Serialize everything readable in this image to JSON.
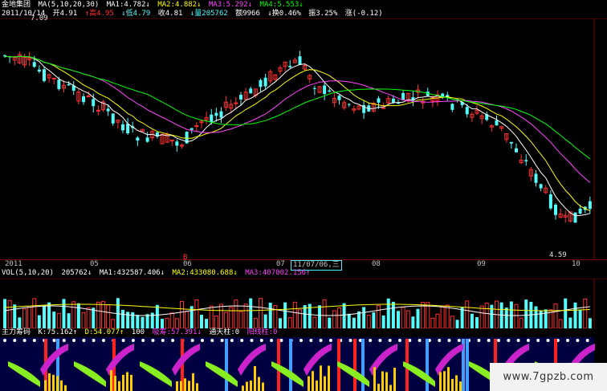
{
  "header": {
    "stock_name": "金地集团",
    "ma_title": "MA(5,10,20,30)",
    "ma1": "MA1:4.782↓",
    "ma2": "MA2:4.882↓",
    "ma3": "MA3:5.292↓",
    "ma4": "MA4:5.553↓",
    "colors": {
      "ma1": "#ffffff",
      "ma2": "#ffff00",
      "ma3": "#ff44ff",
      "ma4": "#00ff00",
      "name": "#ffffff"
    }
  },
  "quote": {
    "date": "2011/10/14",
    "open": "开4.91",
    "high": "↑高4.95",
    "low": "↓低4.79",
    "close": "收4.81",
    "volume": "↓量205762",
    "amount": "额9966",
    "turnover": "↓换0.46%",
    "amplitude": "振3.25%",
    "change": "涨(-0.12)"
  },
  "price_labels": {
    "high": "7.09",
    "low": "4.59",
    "marker": "B"
  },
  "date_axis": {
    "labels": [
      "2011",
      "05",
      "06",
      "07",
      "11/07/06,三",
      "08",
      "09",
      "10"
    ]
  },
  "volume_header": {
    "title": "VOL(5,10,20)",
    "vol": "205762↓",
    "ma1": "MA1:432587.406↓",
    "ma2": "MA2:433080.688↓",
    "ma3": "MA3:407002.156↑"
  },
  "indicator_header": {
    "name": "主力筹码",
    "k": "K:75.162↑",
    "d": "D:54.077↑",
    "n100": "100",
    "xichou": "吸筹:57.391↓",
    "tongtian": "通天柱:0",
    "yangxian": "阳线柱:0"
  },
  "watermark": "www.7gpzb.com",
  "colors": {
    "up": "#ff3030",
    "down": "#54fcfc",
    "axis": "#c0c0c0",
    "grid": "#7a0000"
  }
}
